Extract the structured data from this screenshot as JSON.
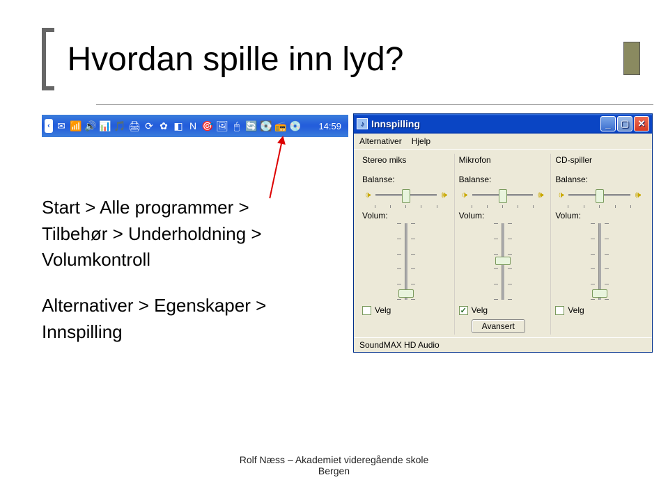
{
  "slide": {
    "title": "Hvordan spille inn lyd?"
  },
  "taskbar": {
    "clock": "14:59",
    "icons": [
      "✉",
      "📶",
      "🔊",
      "📊",
      "🎵",
      "🖨",
      "⟳",
      "✿",
      "◧",
      "N",
      "🎯",
      "🖼",
      "🖱",
      "🔄",
      "💽",
      "📻",
      "💿"
    ]
  },
  "instructions": {
    "path1_a": "Start > Alle programmer >",
    "path1_b": "Tilbehør > Underholdning >",
    "path1_c": "Volumkontroll",
    "path2_a": "Alternativer > Egenskaper >",
    "path2_b": "Innspilling"
  },
  "dialog": {
    "title": "Innspilling",
    "menu": [
      "Alternativer",
      "Hjelp"
    ],
    "channels": [
      {
        "name": "Stereo miks",
        "balance": "Balanse:",
        "volume": "Volum:",
        "checked": false,
        "select": "Velg",
        "thumb": 95,
        "adv": false
      },
      {
        "name": "Mikrofon",
        "balance": "Balanse:",
        "volume": "Volum:",
        "checked": true,
        "select": "Velg",
        "thumb": 48,
        "adv": true,
        "adv_label": "Avansert"
      },
      {
        "name": "CD-spiller",
        "balance": "Balanse:",
        "volume": "Volum:",
        "checked": false,
        "select": "Velg",
        "thumb": 95,
        "adv": false
      }
    ],
    "status": "SoundMAX HD Audio"
  },
  "footer": {
    "line1": "Rolf Næss – Akademiet videregående skole",
    "line2": "Bergen"
  }
}
